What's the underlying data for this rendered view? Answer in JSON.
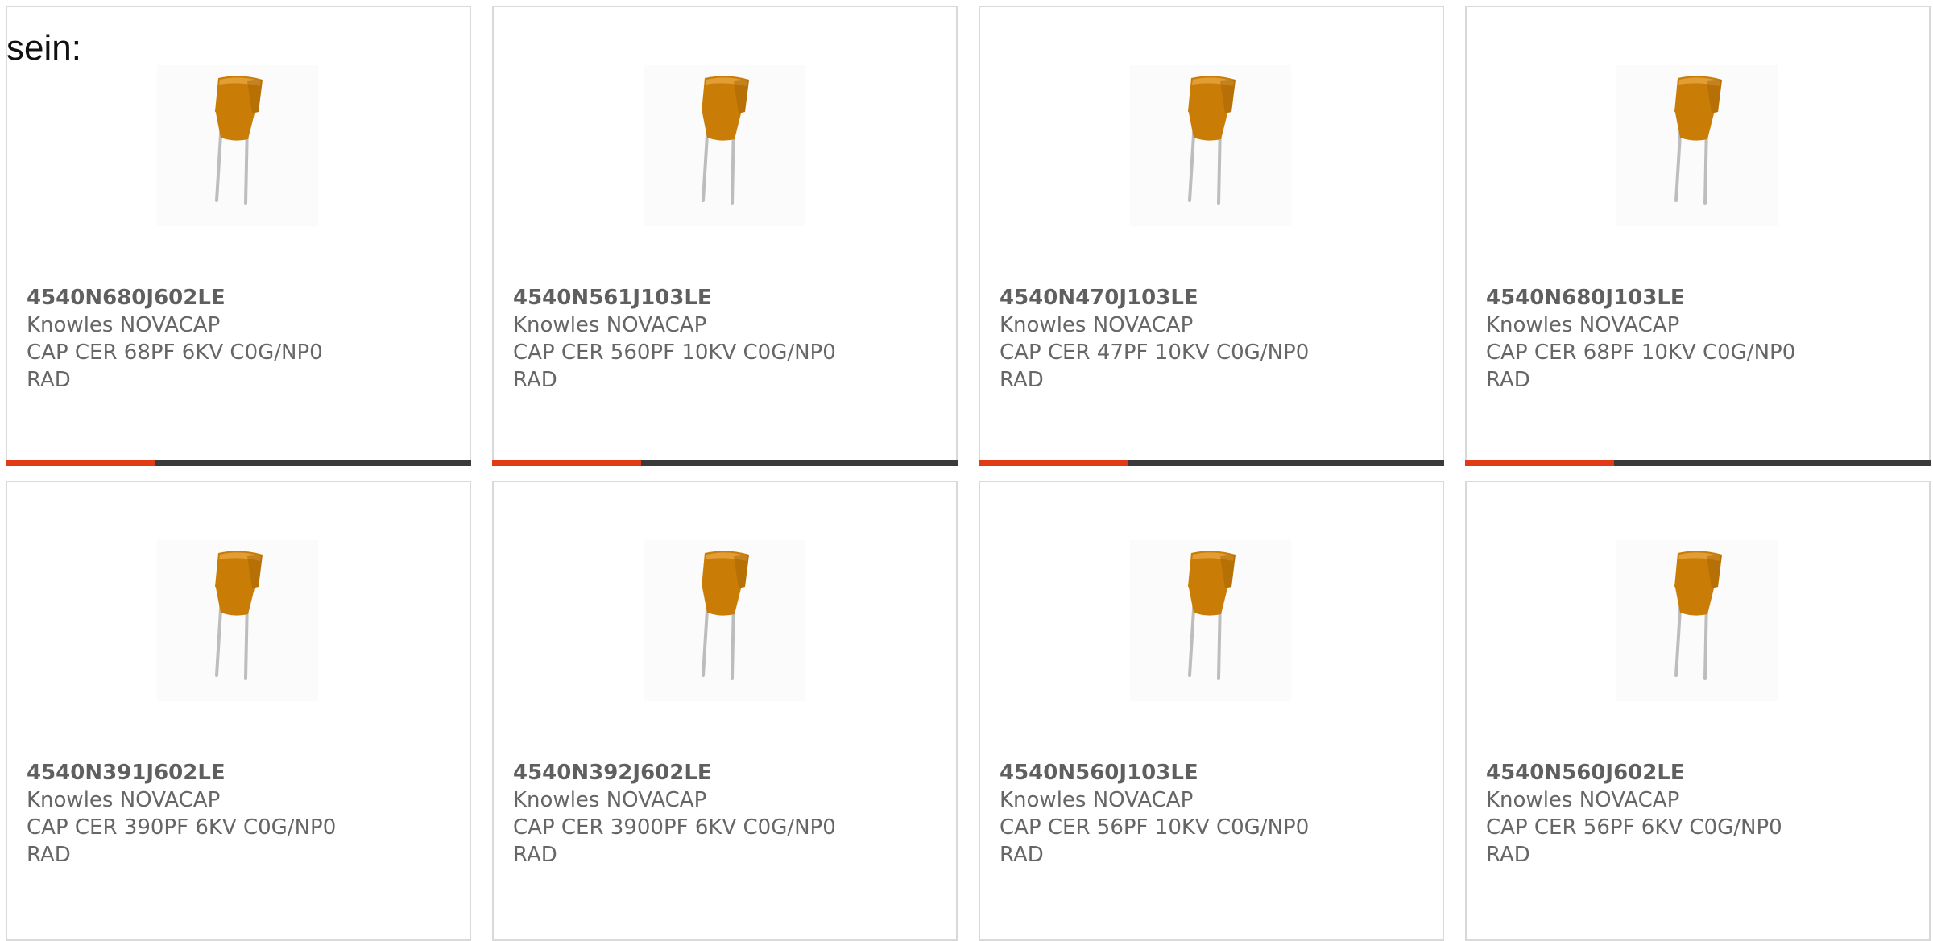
{
  "lead_text": "sein:",
  "colors": {
    "accent": "#e03a17",
    "track": "#3a3a3a",
    "capacitor_body": "#c97d07"
  },
  "cards": [
    {
      "part_number": "4540N680J602LE",
      "manufacturer": "Knowles NOVACAP",
      "description": "CAP CER 68PF 6KV C0G/NP0 RAD",
      "image_icon": "radial-ceramic-capacitor-icon",
      "progress": 0.32
    },
    {
      "part_number": "4540N561J103LE",
      "manufacturer": "Knowles NOVACAP",
      "description": "CAP CER 560PF 10KV C0G/NP0 RAD",
      "image_icon": "radial-ceramic-capacitor-icon",
      "progress": 0.32
    },
    {
      "part_number": "4540N470J103LE",
      "manufacturer": "Knowles NOVACAP",
      "description": "CAP CER 47PF 10KV C0G/NP0 RAD",
      "image_icon": "radial-ceramic-capacitor-icon",
      "progress": 0.32
    },
    {
      "part_number": "4540N680J103LE",
      "manufacturer": "Knowles NOVACAP",
      "description": "CAP CER 68PF 10KV C0G/NP0 RAD",
      "image_icon": "radial-ceramic-capacitor-icon",
      "progress": 0.32
    },
    {
      "part_number": "4540N391J602LE",
      "manufacturer": "Knowles NOVACAP",
      "description": "CAP CER 390PF 6KV C0G/NP0 RAD",
      "image_icon": "radial-ceramic-capacitor-icon",
      "progress": 0
    },
    {
      "part_number": "4540N392J602LE",
      "manufacturer": "Knowles NOVACAP",
      "description": "CAP CER 3900PF 6KV C0G/NP0 RAD",
      "image_icon": "radial-ceramic-capacitor-icon",
      "progress": 0
    },
    {
      "part_number": "4540N560J103LE",
      "manufacturer": "Knowles NOVACAP",
      "description": "CAP CER 56PF 10KV C0G/NP0 RAD",
      "image_icon": "radial-ceramic-capacitor-icon",
      "progress": 0
    },
    {
      "part_number": "4540N560J602LE",
      "manufacturer": "Knowles NOVACAP",
      "description": "CAP CER 56PF 6KV C0G/NP0 RAD",
      "image_icon": "radial-ceramic-capacitor-icon",
      "progress": 0
    }
  ]
}
